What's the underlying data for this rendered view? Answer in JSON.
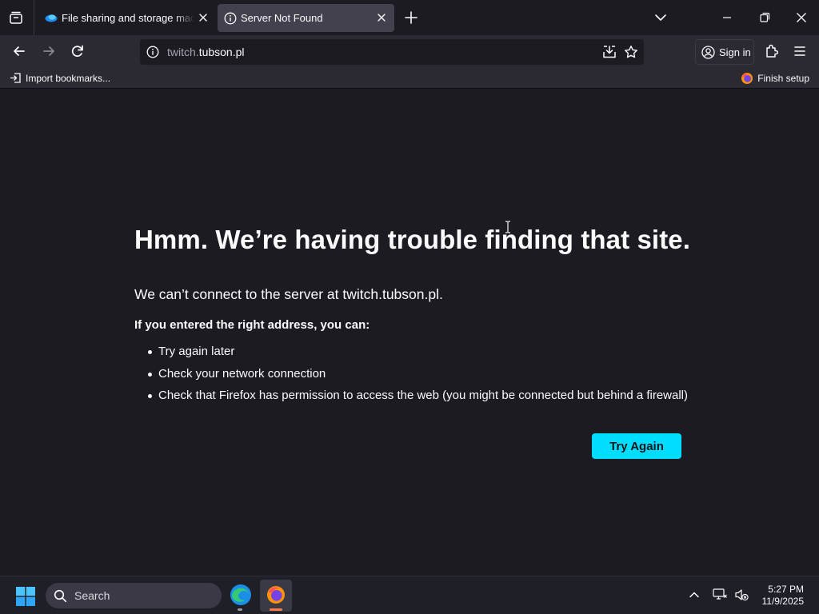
{
  "tabs": [
    {
      "title": "File sharing and storage made s",
      "favicon": "cloud-icon",
      "active": false
    },
    {
      "title": "Server Not Found",
      "favicon": "info-icon",
      "active": true
    }
  ],
  "urlbar": {
    "host_prefix": "twitch.",
    "host_main": "tubson.pl"
  },
  "account": {
    "sign_in_label": "Sign in"
  },
  "bookmarks": {
    "import_label": "Import bookmarks...",
    "finish_setup_label": "Finish setup"
  },
  "error": {
    "title": "Hmm. We’re having trouble finding that site.",
    "description": "We can’t connect to the server at twitch.tubson.pl.",
    "suggestion_heading": "If you entered the right address, you can:",
    "suggestions": [
      "Try again later",
      "Check your network connection",
      "Check that Firefox has permission to access the web (you might be connected but behind a firewall)"
    ],
    "try_again_label": "Try Again"
  },
  "taskbar": {
    "search_label": "Search",
    "time": "5:27 PM",
    "date": "11/9/2025"
  },
  "colors": {
    "background": "#1c1b22",
    "toolbar": "#2b2a33",
    "active_tab": "#42414d",
    "accent_button": "#00ddff",
    "taskbar": "#1f1f28"
  }
}
